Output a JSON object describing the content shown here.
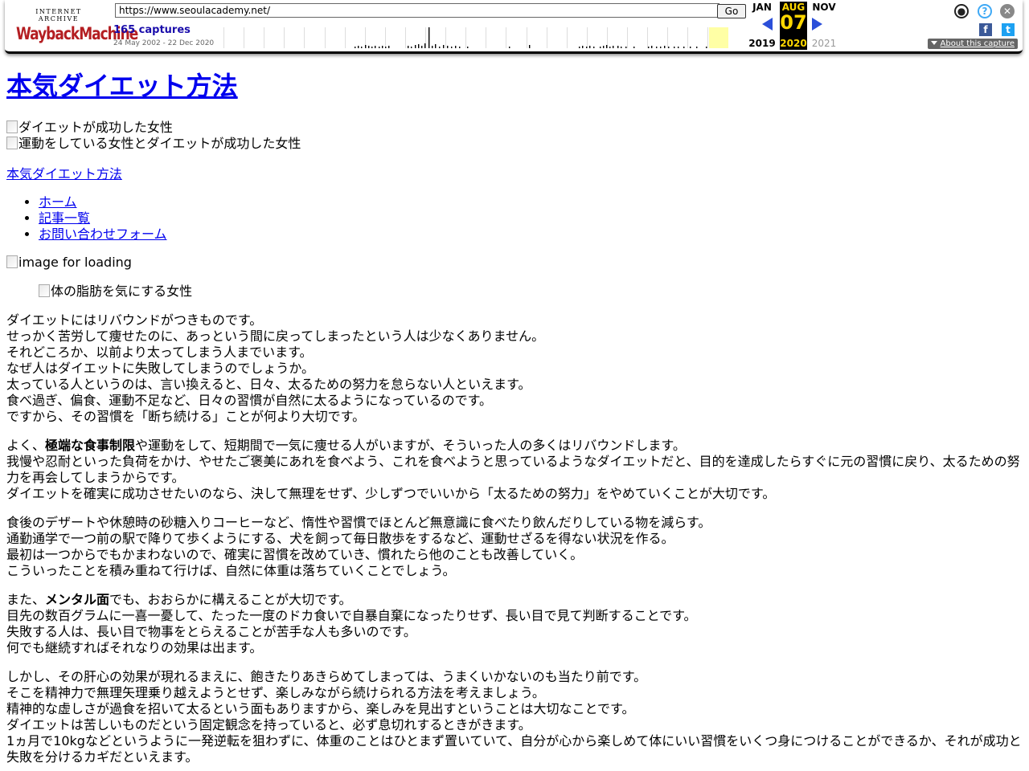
{
  "wayback": {
    "logo_top": "INTERNET ARCHIVE",
    "logo_main": "WaybackMachine",
    "url": "https://www.seoulacademy.net/",
    "go_label": "Go",
    "captures": "165 captures",
    "range": "24 May 2002 - 22 Dec 2020",
    "prev_month": "JAN",
    "cur_month": "AUG",
    "next_month": "NOV",
    "day": "07",
    "prev_year": "2019",
    "cur_year": "2020",
    "next_year": "2021",
    "about": "About this capture",
    "colors": {
      "accent": "#ffd700",
      "arrow": "#2b4fd9",
      "highlight": "#ffffa5"
    }
  },
  "page": {
    "title": "本気ダイエット方法",
    "header_images": [
      "ダイエットが成功した女性",
      "運動をしている女性とダイエットが成功した女性"
    ],
    "site_link": "本気ダイエット方法",
    "nav": [
      "ホーム",
      "記事一覧",
      "お問い合わせフォーム"
    ],
    "loading_alt": "image for loading",
    "article_image_alt": "体の脂肪を気にする女性",
    "p1": [
      "ダイエットにはリバウンドがつきものです。",
      "せっかく苦労して痩せたのに、あっという間に戻ってしまったという人は少なくありません。",
      "それどころか、以前より太ってしまう人までいます。",
      "なぜ人はダイエットに失敗してしまうのでしょうか。",
      "太っている人というのは、言い換えると、日々、太るための努力を怠らない人といえます。",
      "食べ過ぎ、偏食、運動不足など、日々の習慣が自然に太るようになっているのです。",
      "ですから、その習慣を「断ち続ける」ことが何より大切です。"
    ],
    "p2_a": "よく、",
    "p2_bold": "極端な食事制限",
    "p2_b": "や運動をして、短期間で一気に痩せる人がいますが、そういった人の多くはリバウンドします。",
    "p2_rest": [
      "我慢や忍耐といった負荷をかけ、やせたご褒美にあれを食べよう、これを食べようと思っているようなダイエットだと、目的を達成したらすぐに元の習慣に戻り、太るための努力を再会してしまうからです。",
      "ダイエットを確実に成功させたいのなら、決して無理をせず、少しずつでいいから「太るための努力」をやめていくことが大切です。"
    ],
    "p3": [
      "食後のデザートや休憩時の砂糖入りコーヒーなど、惰性や習慣でほとんど無意識に食べたり飲んだりしている物を減らす。",
      "通勤通学で一つ前の駅で降りて歩くようにする、犬を飼って毎日散歩をするなど、運動せざるを得ない状況を作る。",
      "最初は一つからでもかまわないので、確実に習慣を改めていき、慣れたら他のことも改善していく。",
      "こういったことを積み重ねて行けば、自然に体重は落ちていくことでしょう。"
    ],
    "p4_a": "また、",
    "p4_bold": "メンタル面",
    "p4_b": "でも、おおらかに構えることが大切です。",
    "p4_rest": [
      "目先の数百グラムに一喜一憂して、たった一度のドカ食いで自暴自棄になったりせず、長い目で見て判断することです。",
      "失敗する人は、長い目で物事をとらえることが苦手な人も多いのです。",
      "何でも継続すればそれなりの効果は出ます。"
    ],
    "p5": [
      "しかし、その肝心の効果が現れるまえに、飽きたりあきらめてしまっては、うまくいかないのも当たり前です。",
      "そこを精神力で無理矢理乗り越えようとせず、楽しみながら続けられる方法を考えましょう。",
      "精神的な虚しさが過食を招いて太るという面もありますから、楽しみを見出すということは大切なことです。",
      "ダイエットは苦しいものだという固定観念を持っていると、必ず息切れするときがきます。",
      "1ヵ月で10kgなどというように一発逆転を狙わずに、体重のことはひとまず置いていて、自分が心から楽しめて体にいい習慣をいくつ身につけることができるか、それが成功と失敗を分けるカギだといえます。"
    ]
  }
}
